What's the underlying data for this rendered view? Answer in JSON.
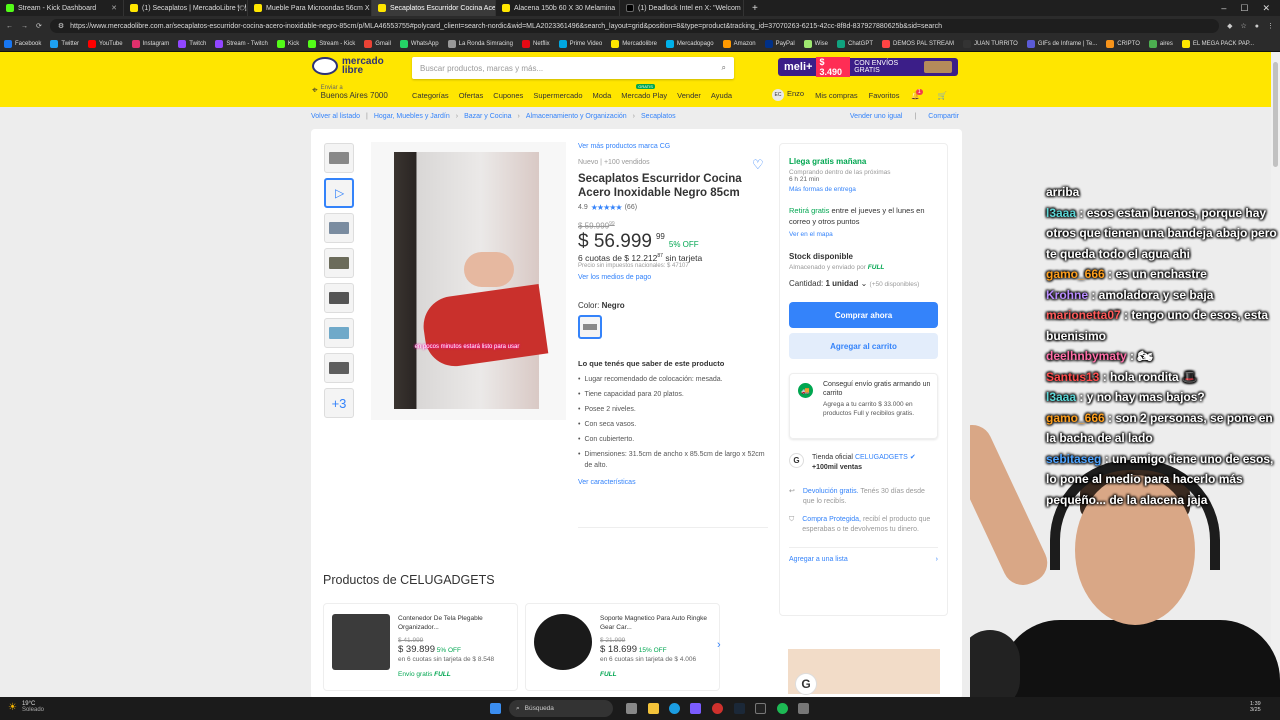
{
  "browser": {
    "tabs": [
      {
        "title": "Stream - Kick Dashboard",
        "color": "#53fc18"
      },
      {
        "title": "(1) Secaplatos | MercadoLibre 🍽",
        "color": "#ffe600"
      },
      {
        "title": "Mueble Para Microondas 56cm X",
        "color": "#ffe600"
      },
      {
        "title": "Secaplatos Escurridor Cocina Ace",
        "color": "#ffe600"
      },
      {
        "title": "Alacena 150b 60 X 30 Melamina",
        "color": "#ffe600"
      },
      {
        "title": "(1) Deadlock Intel en X: \"Welcom",
        "color": "#000000"
      }
    ],
    "url": "https://www.mercadolibre.com.ar/secaplatos-escurridor-cocina-acero-inoxidable-negro-85cm/p/MLA46553755#polycard_client=search-nordic&wid=MLA2023361496&search_layout=grid&position=8&type=product&tracking_id=37070263-6215-42cc-8f8d-837927880625b&sid=search",
    "bookmarks": [
      "Facebook",
      "Twitter",
      "YouTube",
      "Instagram",
      "Twitch",
      "Stream - Twitch",
      "Kick",
      "Stream - Kick",
      "Gmail",
      "WhatsApp",
      "La Ronda Simracing",
      "Netflix",
      "Prime Video",
      "Mercadolibre",
      "Mercadopago",
      "Amazon",
      "PayPal",
      "Wise",
      "ChatGPT",
      "DEMOS PAL STREAM",
      "JUAN TURRITO",
      "GIFs de Inframe | Te...",
      "CRIPTO",
      "aires",
      "EL MEGA PACK PAP..."
    ]
  },
  "header": {
    "logo": "mercado libre",
    "search_placeholder": "Buscar productos, marcas y más...",
    "promo": {
      "brand": "meli+",
      "price": "$ 3.490",
      "text": "CON ENVÍOS GRATIS"
    },
    "location_label": "Enviar a",
    "location": "Buenos Aires 7000",
    "nav": [
      "Categorías",
      "Ofertas",
      "Cupones",
      "Supermercado",
      "Moda",
      "Mercado Play",
      "Vender",
      "Ayuda"
    ],
    "mercado_play_badge": "GRATIS",
    "user_initials": "EC",
    "user": "Enzo",
    "mis_compras": "Mis compras",
    "favoritos": "Favoritos",
    "notif_count": "1"
  },
  "breadcrumb": {
    "back": "Volver al listado",
    "items": [
      "Hogar, Muebles y Jardín",
      "Bazar y Cocina",
      "Almacenamiento y Organización",
      "Secaplatos"
    ],
    "sell_same": "Vender uno igual",
    "share": "Compartir"
  },
  "product": {
    "more_link": "Ver más productos marca CG",
    "condition": "Nuevo  |  +100 vendidos",
    "title": "Secaplatos Escurridor Cocina Acero Inoxidable Negro 85cm",
    "rating": "4.9",
    "stars": "★★★★★",
    "reviews": "(66)",
    "old_price": "$ 59.999",
    "old_price_cents": "99",
    "price": "$ 56.999",
    "price_cents": "99",
    "discount": "5% OFF",
    "installments": "6 cuotas de $ 12.212",
    "installments_cents": "87",
    "installments_suffix": "sin tarjeta",
    "tax_note": "Precio sin impuestos nacionales: $ 47107",
    "payment_link": "Ver los medios de pago",
    "color_label": "Color:",
    "color_value": "Negro",
    "thumbs_more": "+3",
    "image_caption": "en pocos minutos estará listo para usar",
    "features_title": "Lo que tenés que saber de este producto",
    "features": [
      "Lugar recomendado de colocación: mesada.",
      "Tiene capacidad para 20 platos.",
      "Posee 2 niveles.",
      "Con seca vasos.",
      "Con cubierterto.",
      "Dimensiones: 31.5cm de ancho x 85.5cm de largo x 52cm de alto."
    ],
    "features_link": "Ver características"
  },
  "buybox": {
    "arrives": "Llega gratis mañana",
    "arrives_note": "Comprando dentro de las próximas",
    "arrives_time": "6 h 21 min",
    "more_forms": "Más formas de entrega",
    "pickup_green": "Retirá gratis",
    "pickup_text": "entre el jueves y el lunes en correo y otros puntos",
    "map_link": "Ver en el mapa",
    "stock": "Stock disponible",
    "stock_note": "Almacenado y enviado por",
    "full": "FULL",
    "qty_label": "Cantidad:",
    "qty_value": "1 unidad",
    "qty_avail": "(+50 disponibles)",
    "buy_now": "Comprar ahora",
    "add_cart": "Agregar al carrito",
    "envio_title": "Conseguí envío gratis armando un carrito",
    "envio_text": "Agrega a tu carrito $ 33.000 en productos Full y recibilos gratis.",
    "store_label": "Tienda oficial",
    "store_name": "CELUGADGETS",
    "store_sales": "+100mil ventas",
    "return_link": "Devolución gratis.",
    "return_text": "Tenés 30 días desde que lo recibís.",
    "protect_link": "Compra Protegida,",
    "protect_text": "recibí el producto que esperabas o te devolvemos tu dinero.",
    "add_list": "Agregar a una lista"
  },
  "related": {
    "title": "Productos de CELUGADGETS",
    "items": [
      {
        "name": "Contenedor De Tela Plegable Organizador...",
        "old": "$ 41.999",
        "price": "$ 39.899",
        "off": "5% OFF",
        "cuotas": "en 6 cuotas sin tarjeta de $ 8.548",
        "envio": "Envío gratis",
        "full": "FULL"
      },
      {
        "name": "Soporte Magnetico Para Auto Ringke Gear Car...",
        "old": "$ 21.999",
        "price": "$ 18.699",
        "off": "15% OFF",
        "cuotas": "en 6 cuotas sin tarjeta de $ 4.006",
        "envio": "",
        "full": "FULL"
      }
    ]
  },
  "chat": [
    {
      "user": "",
      "msg": "arriba",
      "color": "#ffffff"
    },
    {
      "user": "l3aaa",
      "msg": ": esos estan buenos, porque hay otros que tienen una bandeja abajo pero te queda todo el agua ahi",
      "color": "#5cd6d6"
    },
    {
      "user": "gamo_666",
      "msg": ": es un enchastre",
      "color": "#ff9f1c"
    },
    {
      "user": "Krohne",
      "msg": ": amoladora y se baja",
      "color": "#b98cff"
    },
    {
      "user": "marionetta07",
      "msg": ": tengo uno de esos, esta buenisimo",
      "color": "#ff5a5a"
    },
    {
      "user": "deelhnbymaty",
      "msg": ": 🏍",
      "color": "#ff6fa8"
    },
    {
      "user": "Santus13",
      "msg": ": hola rondita 🎩",
      "color": "#ff4d4d"
    },
    {
      "user": "l3aaa",
      "msg": ": y no hay mas bajos?",
      "color": "#5cd6d6"
    },
    {
      "user": "gamo_666",
      "msg": ": son 2 personas, se pone en la bacha de al lado",
      "color": "#ff9f1c"
    },
    {
      "user": "sebitaseg",
      "msg": ": un amigo tiene uno de esos, lo pone al medio para hacerlo más pequeño... de la alacena jaja",
      "color": "#4da3ff"
    }
  ],
  "taskbar": {
    "temp": "19°C",
    "weather": "Soleado",
    "search": "Búsqueda",
    "time": "1:39",
    "date": "3/25"
  }
}
